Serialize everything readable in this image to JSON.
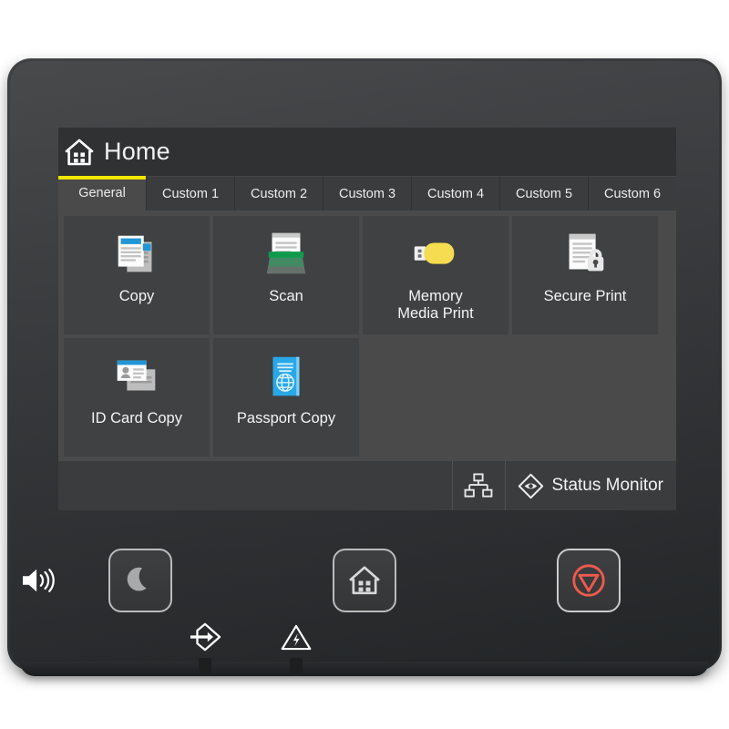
{
  "device": {
    "name": "printer-control-panel"
  },
  "screen": {
    "header": {
      "icon": "home-icon",
      "title": "Home"
    },
    "tabs": [
      {
        "label": "General",
        "active": true
      },
      {
        "label": "Custom 1",
        "active": false
      },
      {
        "label": "Custom 2",
        "active": false
      },
      {
        "label": "Custom 3",
        "active": false
      },
      {
        "label": "Custom 4",
        "active": false
      },
      {
        "label": "Custom 5",
        "active": false
      },
      {
        "label": "Custom 6",
        "active": false
      }
    ],
    "apps": [
      {
        "label": "Copy",
        "icon": "copy-documents-icon",
        "name": "copy"
      },
      {
        "label": "Scan",
        "icon": "scanner-icon",
        "name": "scan"
      },
      {
        "label": "Memory\nMedia Print",
        "icon": "usb-drive-icon",
        "name": "memory-media-print"
      },
      {
        "label": "Secure Print",
        "icon": "document-lock-icon",
        "name": "secure-print"
      },
      {
        "label": "ID Card Copy",
        "icon": "id-card-icon",
        "name": "id-card-copy"
      },
      {
        "label": "Passport Copy",
        "icon": "passport-book-icon",
        "name": "passport-copy"
      }
    ],
    "status_bar": {
      "network_icon": "network-tree-icon",
      "status_monitor_icon": "status-monitor-diamond-icon",
      "status_monitor_label": "Status Monitor"
    }
  },
  "hardware_keys": [
    {
      "name": "sleep-key",
      "icon": "moon-icon"
    },
    {
      "name": "home-key",
      "icon": "home-icon"
    },
    {
      "name": "stop-key",
      "icon": "stop-icon"
    }
  ],
  "indicators": [
    {
      "name": "speaker-indicator",
      "icon": "speaker-volume-icon"
    },
    {
      "name": "data-indicator",
      "icon": "data-arrow-icon"
    },
    {
      "name": "error-indicator",
      "icon": "warning-triangle-icon"
    }
  ],
  "colors": {
    "accent_yellow": "#f2e500",
    "panel_dark": "#35373a",
    "screen_bg": "#2f3133",
    "grid_bg": "#4a4a4a",
    "tile_bg": "#3f4143",
    "tab_bg": "#3a3c3e",
    "copy_blue": "#2196d6",
    "scan_green": "#0f9a4e",
    "usb_yellow": "#f5dc50",
    "passport_blue": "#29a8e8",
    "stop_red": "#ef5a4c",
    "text_light": "#f2f2f2"
  }
}
